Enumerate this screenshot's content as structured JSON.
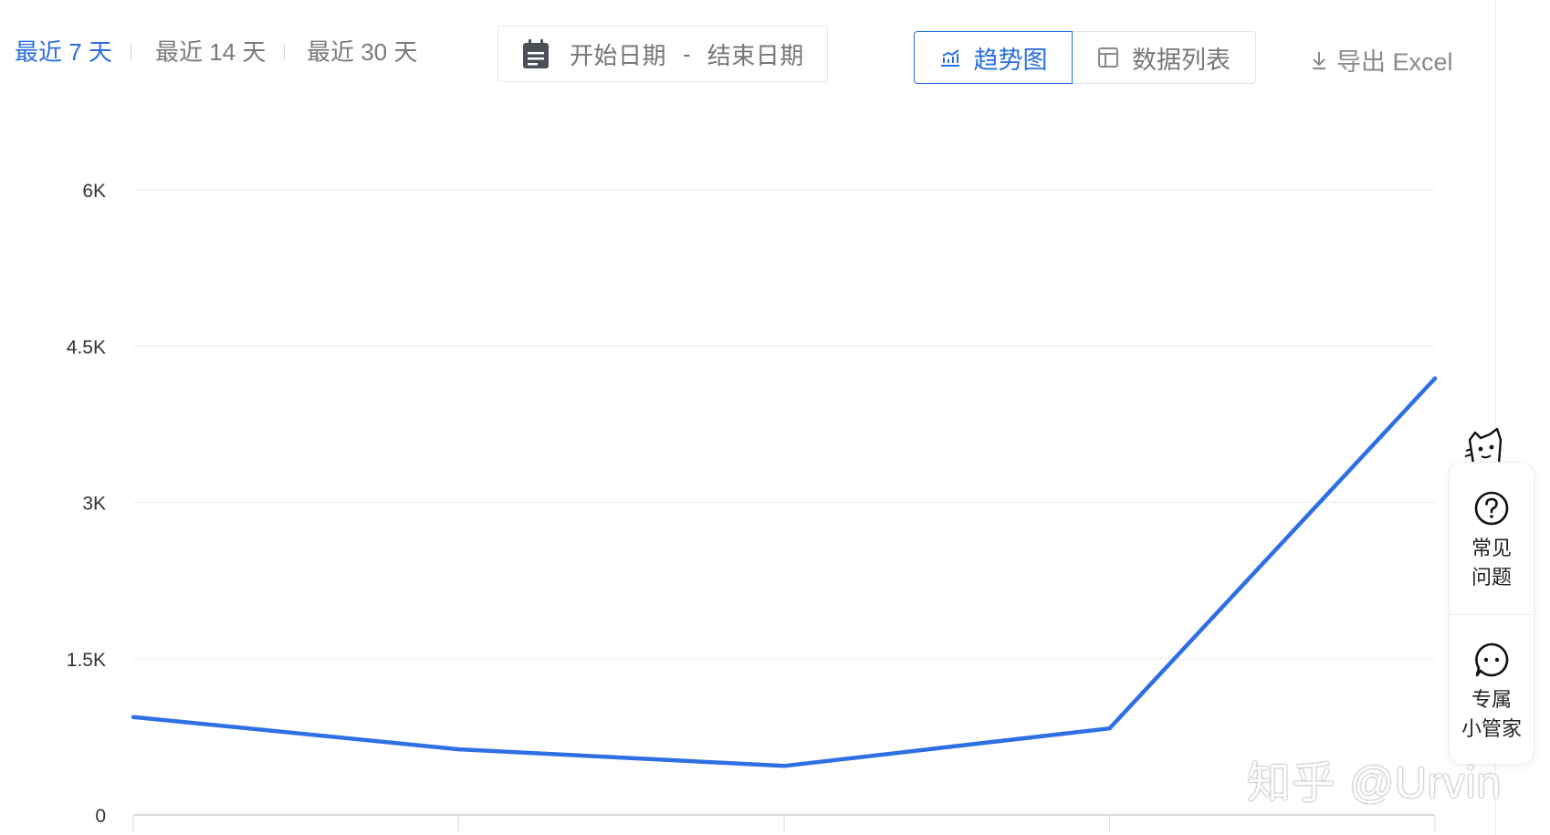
{
  "toolbar": {
    "ranges": [
      {
        "label": "最近 7 天",
        "active": true
      },
      {
        "label": "最近 14 天",
        "active": false
      },
      {
        "label": "最近 30 天",
        "active": false
      }
    ],
    "date_picker": {
      "icon": "calendar-icon",
      "start": "开始日期",
      "separator": "-",
      "end": "结束日期"
    },
    "view_toggle": {
      "trend": {
        "label": "趋势图",
        "icon": "trend-chart-icon",
        "selected": true
      },
      "table": {
        "label": "数据列表",
        "icon": "table-icon",
        "selected": false
      }
    },
    "export": {
      "label": "导出 Excel",
      "icon": "download-icon"
    }
  },
  "chart_data": {
    "type": "line",
    "title": "",
    "xlabel": "",
    "ylabel": "",
    "ylim": [
      0,
      6000
    ],
    "yticks": [
      0,
      1500,
      3000,
      4500,
      6000
    ],
    "ytick_labels": [
      "0",
      "1.5K",
      "3K",
      "4.5K",
      "6K"
    ],
    "grid": true,
    "x": [
      1,
      2,
      3,
      4,
      5
    ],
    "series": [
      {
        "values": [
          940,
          630,
          470,
          830,
          4190
        ],
        "color": "#2f6fe4"
      }
    ]
  },
  "side_panel": {
    "items": [
      {
        "label": "常见\n问题",
        "icon": "question-icon"
      },
      {
        "label": "专属\n小管家",
        "icon": "chat-icon"
      }
    ]
  },
  "watermark": "知乎 @Urvin"
}
